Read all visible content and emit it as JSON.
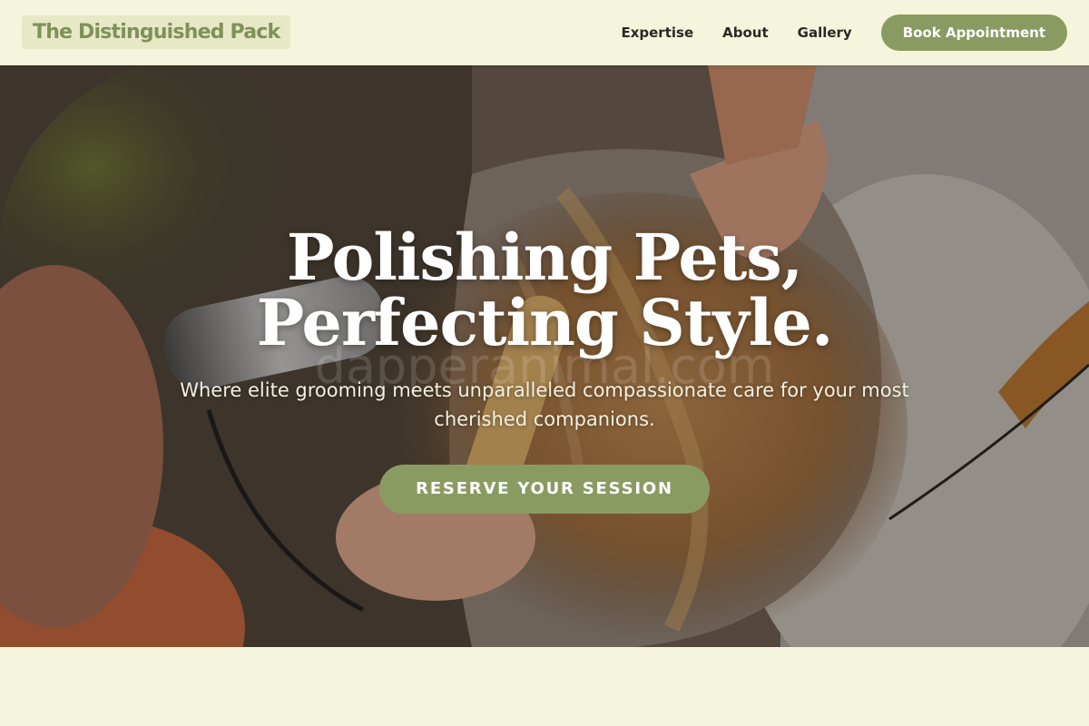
{
  "header": {
    "logo": "The Distinguished Pack",
    "nav": [
      {
        "label": "Expertise"
      },
      {
        "label": "About"
      },
      {
        "label": "Gallery"
      }
    ],
    "cta_label": "Book Appointment"
  },
  "hero": {
    "title": "Polishing Pets, Perfecting Style.",
    "subtitle": "Where elite grooming meets unparalleled compassionate care for your most cherished companions.",
    "cta_label": "RESERVE YOUR SESSION",
    "watermark": "dapperanimal.com"
  },
  "colors": {
    "background": "#f5f4dc",
    "accent": "#8a9b62",
    "logo_bg": "#e6e8c6",
    "logo_text": "#7f915a",
    "nav_text": "#2a2a24"
  }
}
